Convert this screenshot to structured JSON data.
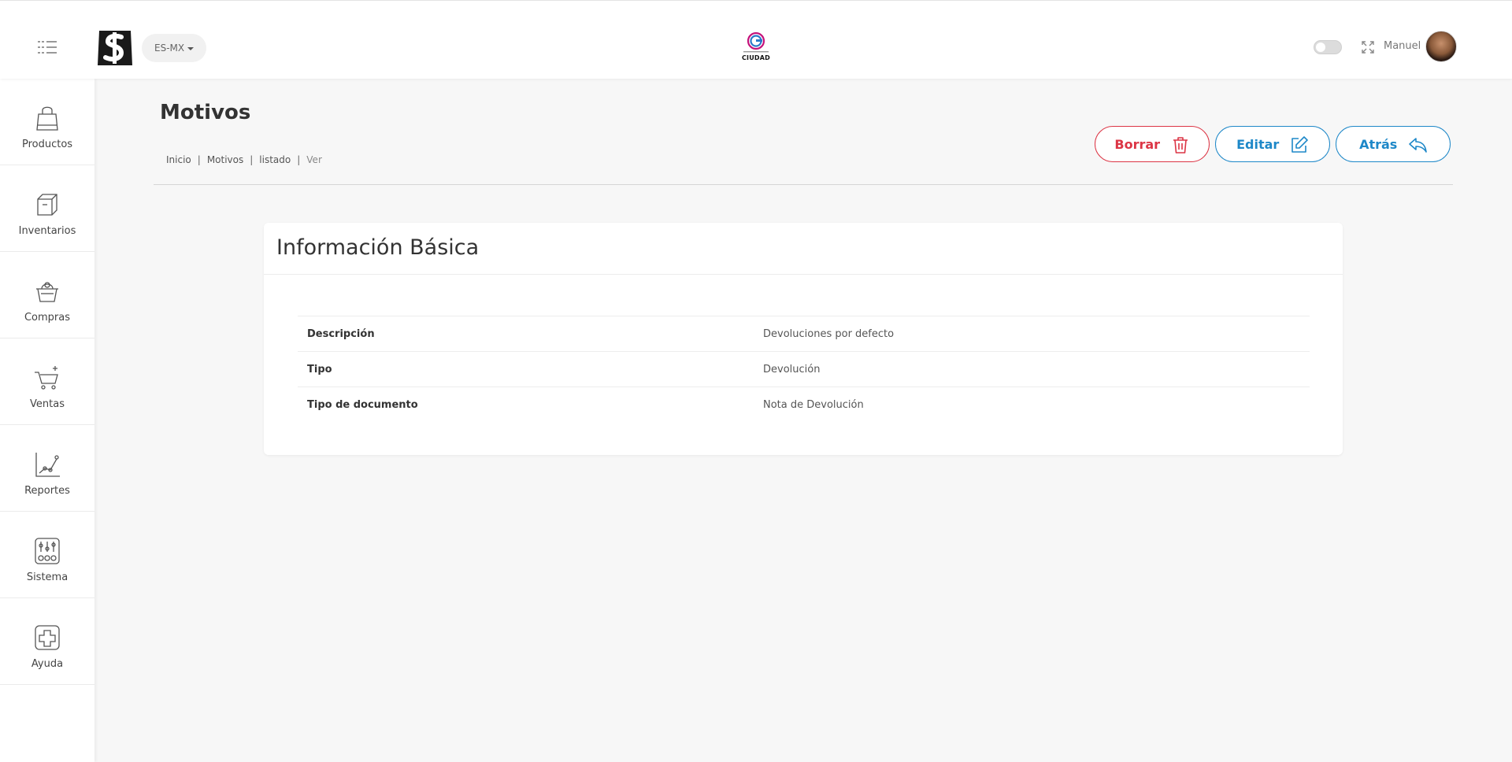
{
  "header": {
    "language": "ES-MX",
    "client_logo_text": "CIUDAD",
    "user_name": "Manuel"
  },
  "sidebar": {
    "items": [
      {
        "label": "Productos",
        "icon": "shopping-bag-icon"
      },
      {
        "label": "Inventarios",
        "icon": "box-icon"
      },
      {
        "label": "Compras",
        "icon": "basket-icon"
      },
      {
        "label": "Ventas",
        "icon": "cart-plus-icon"
      },
      {
        "label": "Reportes",
        "icon": "chart-icon"
      },
      {
        "label": "Sistema",
        "icon": "sliders-icon"
      },
      {
        "label": "Ayuda",
        "icon": "help-plus-icon"
      }
    ]
  },
  "page": {
    "title": "Motivos",
    "breadcrumb": [
      "Inicio",
      "Motivos",
      "listado",
      "Ver"
    ]
  },
  "actions": {
    "delete_label": "Borrar",
    "edit_label": "Editar",
    "back_label": "Atrás"
  },
  "card": {
    "title": "Información Básica",
    "rows": [
      {
        "key": "Descripción",
        "value": "Devoluciones por defecto"
      },
      {
        "key": "Tipo",
        "value": "Devolución"
      },
      {
        "key": "Tipo de documento",
        "value": "Nota de Devolución"
      }
    ]
  },
  "colors": {
    "danger": "#dc3545",
    "primary": "#1e88c8",
    "background": "#f7f7f7"
  }
}
